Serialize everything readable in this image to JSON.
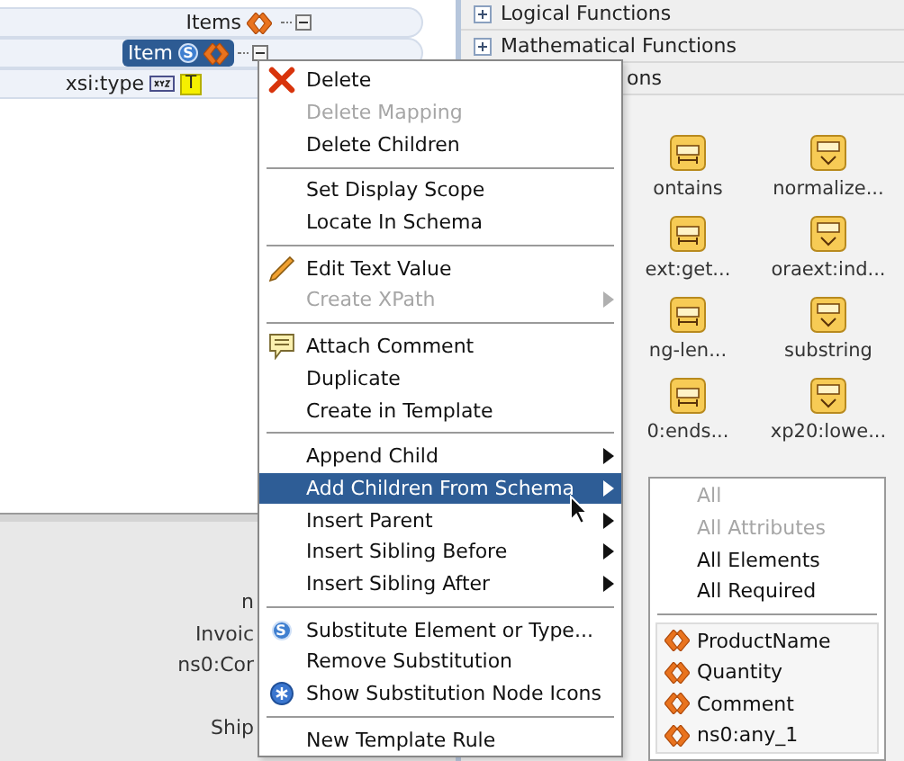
{
  "tree": {
    "nodes": [
      {
        "label": "Items",
        "kind": "element",
        "selected": false,
        "expanded": true,
        "children": [
          {
            "label": "Item",
            "kind": "element",
            "badge": "S",
            "selected": true,
            "expanded": true,
            "children": [
              {
                "label": "xsi:type",
                "kind": "attribute",
                "value_badge": "T",
                "selected": false
              }
            ]
          }
        ]
      }
    ]
  },
  "mapping_panel": {
    "labels": [
      "n",
      "Invoic",
      "ns0:Cor",
      "Ship"
    ]
  },
  "function_panel": {
    "categories": [
      {
        "label": "Logical Functions",
        "expanded": false
      },
      {
        "label": "Mathematical Functions",
        "expanded": false
      }
    ],
    "partial_category": "ons",
    "functions": [
      {
        "label": "ontains"
      },
      {
        "label": "normalize..."
      },
      {
        "label": "ext:get..."
      },
      {
        "label": "oraext:ind..."
      },
      {
        "label": "ng-len..."
      },
      {
        "label": "substring"
      },
      {
        "label": "0:ends..."
      },
      {
        "label": "xp20:lowe..."
      }
    ]
  },
  "context_menu": {
    "items": [
      {
        "kind": "item",
        "label": "Delete",
        "disabled": false,
        "submenu": false,
        "selected": false,
        "checked": false
      },
      {
        "kind": "item",
        "label": "Delete Mapping",
        "disabled": true,
        "submenu": false,
        "selected": false,
        "checked": false
      },
      {
        "kind": "item",
        "label": "Delete Children",
        "disabled": false,
        "submenu": false,
        "selected": false,
        "checked": false
      },
      {
        "kind": "separator"
      },
      {
        "kind": "item",
        "label": "Set Display Scope",
        "disabled": false,
        "submenu": false,
        "selected": false,
        "checked": false
      },
      {
        "kind": "item",
        "label": "Locate In Schema",
        "disabled": false,
        "submenu": false,
        "selected": false,
        "checked": false
      },
      {
        "kind": "separator"
      },
      {
        "kind": "item",
        "label": "Edit Text Value",
        "disabled": false,
        "submenu": false,
        "selected": false,
        "checked": false
      },
      {
        "kind": "item",
        "label": "Create XPath",
        "disabled": true,
        "submenu": true,
        "selected": false,
        "checked": false
      },
      {
        "kind": "separator"
      },
      {
        "kind": "item",
        "label": "Attach Comment",
        "disabled": false,
        "submenu": false,
        "selected": false,
        "checked": false
      },
      {
        "kind": "item",
        "label": "Duplicate",
        "disabled": false,
        "submenu": false,
        "selected": false,
        "checked": false
      },
      {
        "kind": "item",
        "label": "Create in Template",
        "disabled": false,
        "submenu": false,
        "selected": false,
        "checked": false
      },
      {
        "kind": "separator"
      },
      {
        "kind": "item",
        "label": "Append Child",
        "disabled": false,
        "submenu": true,
        "selected": false,
        "checked": false
      },
      {
        "kind": "item",
        "label": "Add Children From Schema",
        "disabled": false,
        "submenu": true,
        "selected": true,
        "checked": false
      },
      {
        "kind": "item",
        "label": "Insert Parent",
        "disabled": false,
        "submenu": true,
        "selected": false,
        "checked": false
      },
      {
        "kind": "item",
        "label": "Insert Sibling Before",
        "disabled": false,
        "submenu": true,
        "selected": false,
        "checked": false
      },
      {
        "kind": "item",
        "label": "Insert Sibling After",
        "disabled": false,
        "submenu": true,
        "selected": false,
        "checked": false
      },
      {
        "kind": "separator"
      },
      {
        "kind": "item",
        "label": "Substitute Element or Type...",
        "badge": "S",
        "disabled": false,
        "submenu": false,
        "selected": false,
        "checked": false
      },
      {
        "kind": "item",
        "label": "Remove Substitution",
        "disabled": false,
        "submenu": false,
        "selected": false,
        "checked": false
      },
      {
        "kind": "item",
        "label": "Show Substitution Node Icons",
        "disabled": false,
        "submenu": false,
        "selected": false,
        "checked": true
      },
      {
        "kind": "separator"
      },
      {
        "kind": "item",
        "label": "New Template Rule",
        "disabled": false,
        "submenu": false,
        "selected": false,
        "checked": false
      }
    ]
  },
  "submenu": {
    "items": [
      {
        "label": "All",
        "disabled": true
      },
      {
        "label": "All Attributes",
        "disabled": true
      },
      {
        "label": "All Elements",
        "disabled": false
      },
      {
        "label": "All Required",
        "disabled": false
      }
    ],
    "elements": [
      {
        "label": "ProductName"
      },
      {
        "label": "Quantity"
      },
      {
        "label": "Comment"
      },
      {
        "label": "ns0:any_1"
      }
    ]
  }
}
